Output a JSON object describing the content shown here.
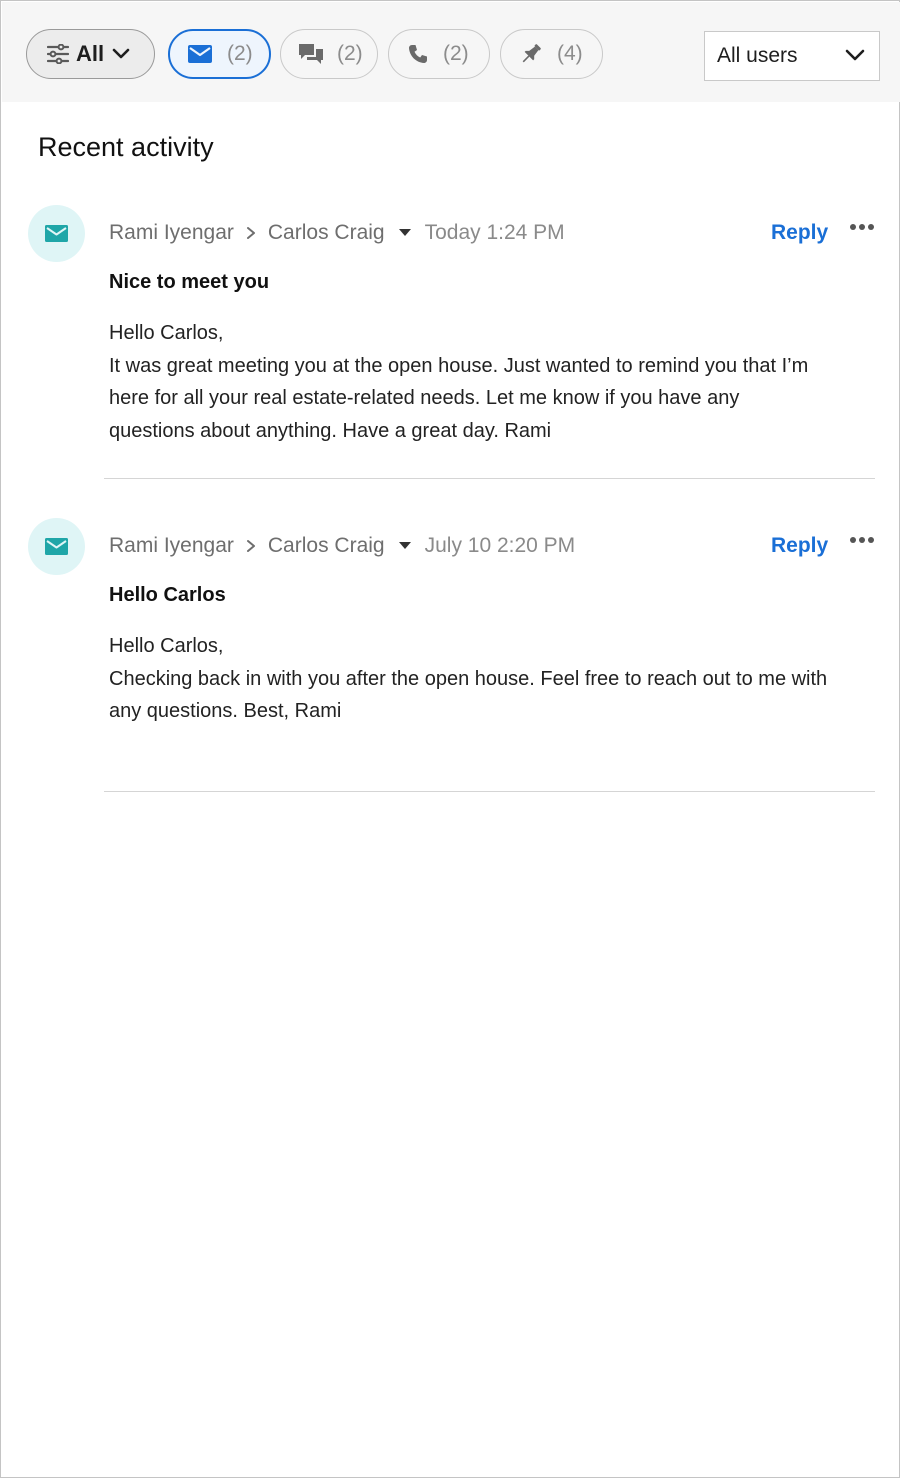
{
  "toolbar": {
    "all_filter": {
      "label": "All",
      "icon": "sliders-icon"
    },
    "type_filters": [
      {
        "icon": "envelope-icon",
        "count": "(2)",
        "selected": true
      },
      {
        "icon": "chat-bubbles-icon",
        "count": "(2)",
        "selected": false
      },
      {
        "icon": "phone-icon",
        "count": "(2)",
        "selected": false
      },
      {
        "icon": "pushpin-icon",
        "count": "(4)",
        "selected": false
      }
    ],
    "user_select": {
      "value": "All users"
    }
  },
  "section_title": "Recent activity",
  "activities": [
    {
      "type_icon": "envelope-icon",
      "from": "Rami Iyengar",
      "to": "Carlos Craig",
      "time": "Today 1:24 PM",
      "reply_label": "Reply",
      "subject": "Nice to meet you",
      "greeting": "Hello Carlos,",
      "body": "It was great meeting you at the open house. Just wanted to remind you that I’m here for all your real estate-related needs. Let me know if you have any questions about anything. Have a great day. Rami"
    },
    {
      "type_icon": "envelope-icon",
      "from": "Rami Iyengar",
      "to": "Carlos Craig",
      "time": "July 10 2:20 PM",
      "reply_label": "Reply",
      "subject": "Hello Carlos",
      "greeting": "Hello Carlos,",
      "body": "Checking back in with you after the open house. Feel free to reach out to me with any questions. Best, Rami"
    }
  ],
  "colors": {
    "accent": "#1a6fd6",
    "email_icon": "#1fa6a8",
    "email_icon_bg": "#dff5f6",
    "toolbar_bg": "#f6f6f6"
  }
}
